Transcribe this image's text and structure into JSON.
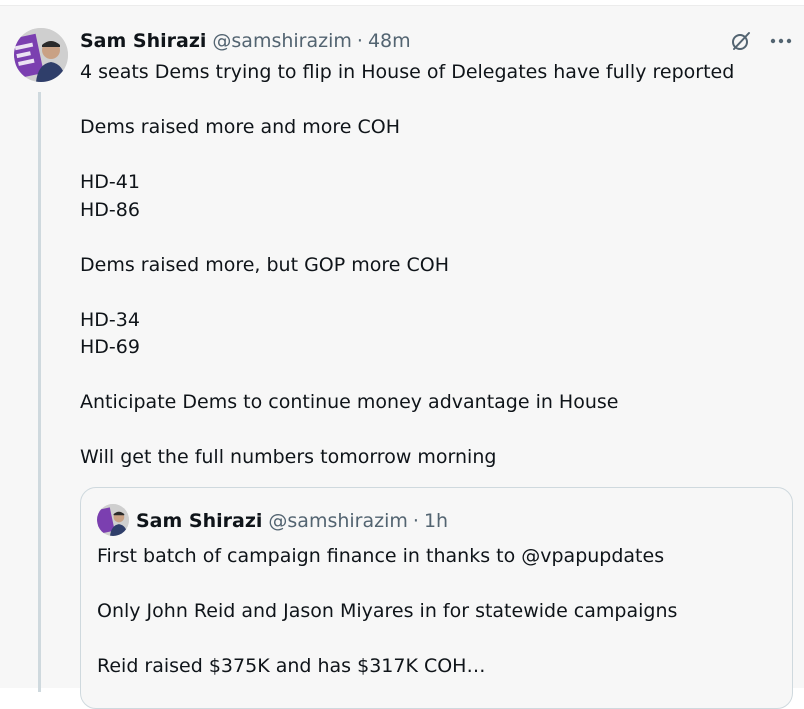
{
  "tweet": {
    "author_name": "Sam Shirazi",
    "handle": "@samshirazim",
    "separator": "·",
    "time": "48m",
    "lines": [
      "4 seats Dems trying to flip in House of Delegates have fully reported",
      "",
      "Dems raised more and more COH",
      "",
      "HD-41",
      "HD-86",
      "",
      "Dems raised more, but GOP more COH",
      "",
      "HD-34",
      "HD-69",
      "",
      "Anticipate Dems to continue money advantage in House",
      "",
      "Will get the full numbers tomorrow morning"
    ]
  },
  "quoted_tweet": {
    "author_name": "Sam Shirazi",
    "handle": "@samshirazim",
    "separator": "·",
    "time": "1h",
    "lines": [
      "First batch of campaign finance in thanks to @vpapupdates",
      "",
      "Only John Reid and Jason Miyares in for statewide campaigns",
      "",
      "Reid raised $375K and has $317K COH…"
    ]
  },
  "icons": {
    "grok": "grok-icon",
    "more": "more-options-icon"
  },
  "colors": {
    "background": "#f7f7f7",
    "text": "#0f1419",
    "secondary": "#536471",
    "border": "#cfd9de",
    "avatar_purple": "#6b2fa0"
  }
}
